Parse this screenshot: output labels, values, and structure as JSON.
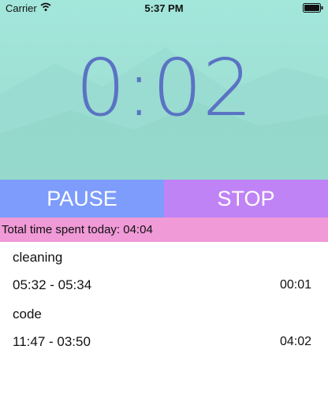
{
  "status_bar": {
    "carrier": "Carrier",
    "time": "5:37 PM"
  },
  "timer": {
    "display": "0:02"
  },
  "controls": {
    "pause_label": "PAUSE",
    "stop_label": "STOP"
  },
  "summary": {
    "total_text": "Total time spent today: 04:04"
  },
  "entries": [
    {
      "title": "cleaning",
      "range": "05:32 - 05:34",
      "duration": "00:01"
    },
    {
      "title": "code",
      "range": "11:47 - 03:50",
      "duration": "04:02"
    }
  ],
  "colors": {
    "timer_text": "#5a73c4",
    "pause_bg": "#7d9cfb",
    "stop_bg": "#c083f6",
    "total_bg": "#f09ad8",
    "hero_bg": "#a3e6db"
  }
}
